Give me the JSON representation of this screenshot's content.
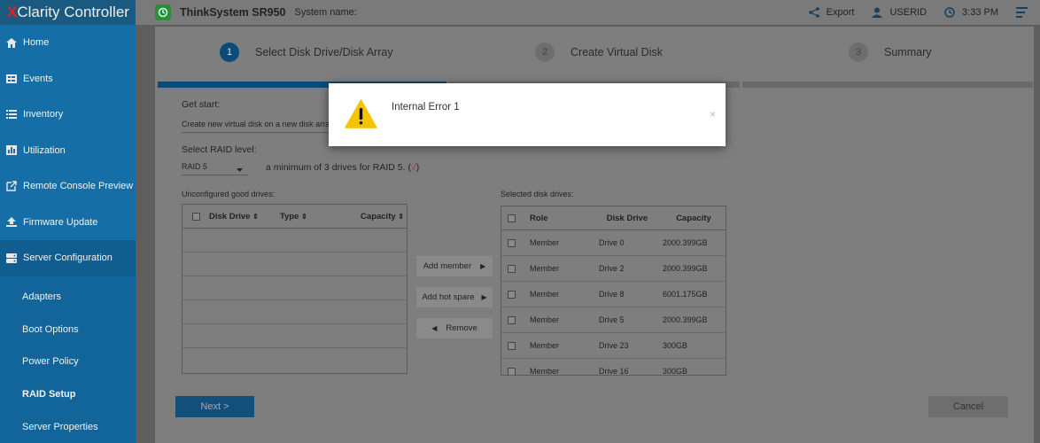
{
  "app": {
    "logo_prefix": "X",
    "logo_text": "Clarity Controller",
    "model": "ThinkSystem SR950",
    "system_name_label": "System name:"
  },
  "topbar": {
    "export_label": "Export",
    "user_label": "USERID",
    "time_label": "3:33 PM"
  },
  "sidebar": {
    "items": [
      {
        "label": "Home",
        "icon": "home-icon"
      },
      {
        "label": "Events",
        "icon": "events-icon"
      },
      {
        "label": "Inventory",
        "icon": "inventory-icon"
      },
      {
        "label": "Utilization",
        "icon": "utilization-icon"
      },
      {
        "label": "Remote Console Preview",
        "icon": "remote-console-icon"
      },
      {
        "label": "Firmware Update",
        "icon": "firmware-icon"
      },
      {
        "label": "Server Configuration",
        "icon": "server-config-icon"
      }
    ],
    "subitems": [
      {
        "label": "Adapters"
      },
      {
        "label": "Boot Options"
      },
      {
        "label": "Power Policy"
      },
      {
        "label": "RAID Setup"
      },
      {
        "label": "Server Properties"
      }
    ]
  },
  "wizard": {
    "steps": [
      {
        "num": "1",
        "label": "Select Disk Drive/Disk Array"
      },
      {
        "num": "2",
        "label": "Create Virtual Disk"
      },
      {
        "num": "3",
        "label": "Summary"
      }
    ],
    "get_start_label": "Get start:",
    "get_start_value": "Create new virtual disk on a new disk arra",
    "raid_label": "Select RAID level:",
    "raid_value": "RAID 5",
    "raid_hint": "a minimum of 3 drives for RAID 5. (",
    "raid_hint_check": "√",
    "raid_hint_end": ")",
    "unconfigured_label": "Unconfigured good drives:",
    "selected_label": "Selected disk drives:",
    "unconfigured_headers": [
      "Disk Drive",
      "Type",
      "Capacity"
    ],
    "selected_headers": [
      "Role",
      "Disk Drive",
      "Capacity"
    ],
    "selected_rows": [
      {
        "role": "Member",
        "drive": "Drive 0",
        "capacity": "2000.399GB"
      },
      {
        "role": "Member",
        "drive": "Drive 2",
        "capacity": "2000.399GB"
      },
      {
        "role": "Member",
        "drive": "Drive 8",
        "capacity": "6001.175GB"
      },
      {
        "role": "Member",
        "drive": "Drive 5",
        "capacity": "2000.399GB"
      },
      {
        "role": "Member",
        "drive": "Drive 23",
        "capacity": "300GB"
      },
      {
        "role": "Member",
        "drive": "Drive 16",
        "capacity": "300GB"
      }
    ],
    "add_member_label": "Add member",
    "add_hot_spare_label": "Add hot spare",
    "remove_label": "Remove",
    "next_label": "Next >",
    "cancel_label": "Cancel"
  },
  "modal": {
    "message": "Internal Error 1",
    "close_glyph": "×"
  },
  "colors": {
    "sidebar": "#156fa6",
    "accent": "#0c4a77",
    "warning": "#f5c400",
    "check": "#d22"
  }
}
